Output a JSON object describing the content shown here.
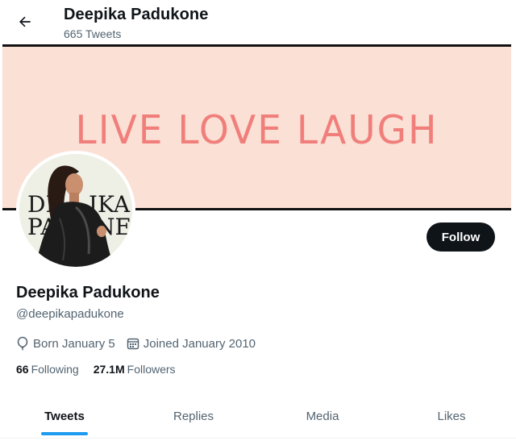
{
  "header": {
    "name": "Deepika Padukone",
    "tweet_count": "665 Tweets"
  },
  "banner": {
    "text": "LIVE LOVE LAUGH",
    "bg_color": "#fbe0d5",
    "text_color": "#f07f7c"
  },
  "avatar": {
    "logo_text_line1": "DEEPIKA",
    "logo_text_line2": "PADUKONE"
  },
  "actions": {
    "follow_label": "Follow"
  },
  "profile": {
    "name": "Deepika Padukone",
    "handle": "@deepikapadukone",
    "born": "Born January 5",
    "joined": "Joined January 2010"
  },
  "stats": {
    "following_count": "66",
    "following_label": "Following",
    "followers_count": "27.1M",
    "followers_label": "Followers"
  },
  "tabs": [
    {
      "label": "Tweets",
      "active": true
    },
    {
      "label": "Replies",
      "active": false
    },
    {
      "label": "Media",
      "active": false
    },
    {
      "label": "Likes",
      "active": false
    }
  ],
  "colors": {
    "accent": "#1d9bf0",
    "text_primary": "#0f1419",
    "text_secondary": "#536471"
  },
  "icons": {
    "back": "arrow-left-icon",
    "born": "balloon-icon",
    "joined": "calendar-icon"
  }
}
